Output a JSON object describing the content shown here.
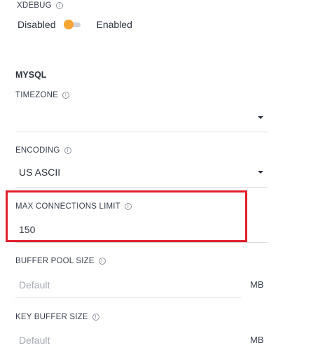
{
  "xdebug": {
    "label": "XDEBUG",
    "info_icon": "info-icon",
    "disabled_label": "Disabled",
    "enabled_label": "Enabled",
    "state": "Disabled",
    "toggle_color": "#f7a533"
  },
  "mysql": {
    "section_title": "MYSQL",
    "timezone": {
      "label": "TIMEZONE",
      "value": ""
    },
    "encoding": {
      "label": "ENCODING",
      "value": "US ASCII"
    },
    "max_connections": {
      "label": "MAX CONNECTIONS LIMIT",
      "value": "150"
    },
    "buffer_pool_size": {
      "label": "BUFFER POOL SIZE",
      "placeholder": "Default",
      "unit": "MB"
    },
    "key_buffer_size": {
      "label": "KEY BUFFER SIZE",
      "placeholder": "Default",
      "unit": "MB"
    }
  },
  "highlight": {
    "target": "max-connections-field",
    "color": "#e0202a"
  }
}
